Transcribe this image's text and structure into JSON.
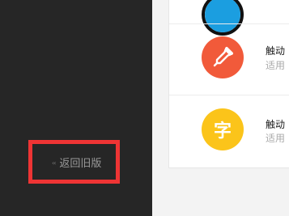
{
  "sidebar": {
    "back_chevron": "‹‹",
    "back_label": "返回旧版"
  },
  "apps": [
    {
      "title": "",
      "subtitle": "",
      "icon": "unknown-icon",
      "color": "#1b9ee0"
    },
    {
      "title": "触动",
      "subtitle": "适用",
      "icon": "eyedropper-icon",
      "color": "#f15a3a"
    },
    {
      "title": "触动",
      "subtitle": "适用",
      "icon": "字",
      "color": "#fbc41a"
    }
  ]
}
